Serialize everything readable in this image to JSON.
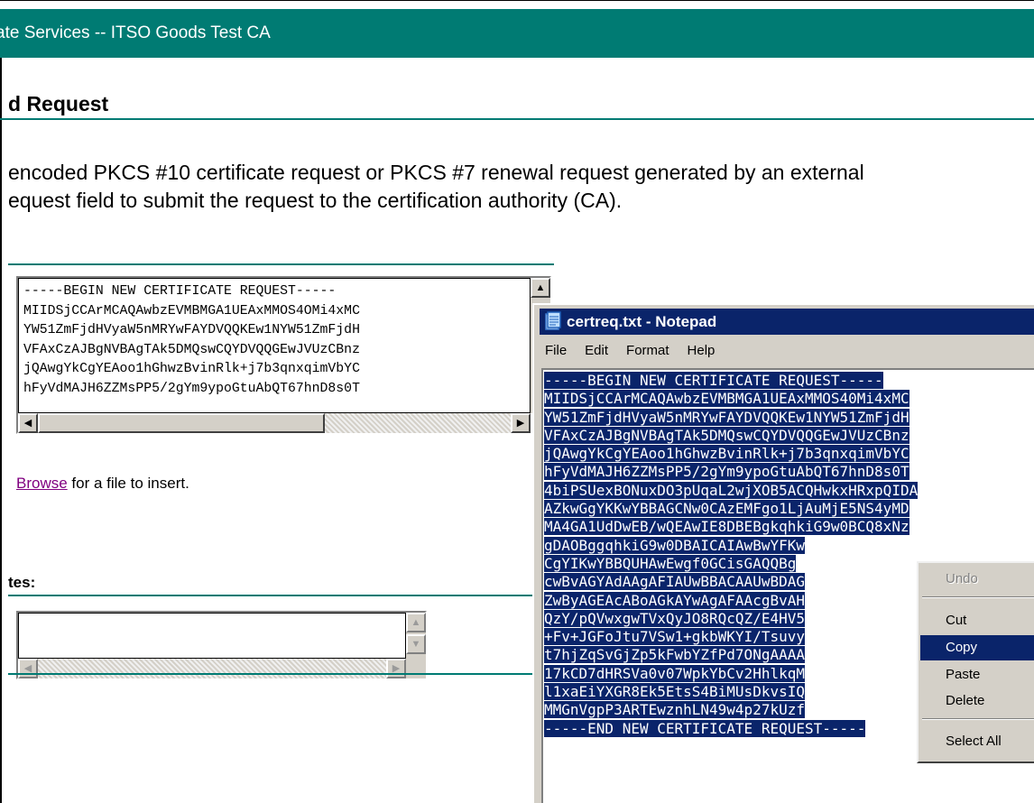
{
  "banner": {
    "title": "ate Services  --  ITSO Goods Test CA"
  },
  "page": {
    "heading": "d Request",
    "description_line1": " encoded PKCS #10 certificate request or PKCS #7 renewal request generated by an external",
    "description_line2": "equest field to submit the request to the certification authority (CA).",
    "browse_link": "Browse",
    "browse_suffix": " for a file to insert.",
    "attributes_label": "tes:"
  },
  "request_box": {
    "lines": [
      "-----BEGIN NEW CERTIFICATE REQUEST-----",
      "MIIDSjCCArMCAQAwbzEVMBMGA1UEAxMMOS4OMi4xMC",
      "YW51ZmFjdHVyaW5nMRYwFAYDVQQKEw1NYW51ZmFjdH",
      "VFAxCzAJBgNVBAgTAk5DMQswCQYDVQQGEwJVUzCBnz",
      "jQAwgYkCgYEAoo1hGhwzBvinRlk+j7b3qnxqimVbYC",
      "hFyVdMAJH6ZZMsPP5/2gYm9ypoGtuAbQT67hnD8s0T"
    ]
  },
  "notepad": {
    "title": "certreq.txt - Notepad",
    "menu": [
      "File",
      "Edit",
      "Format",
      "Help"
    ],
    "lines": [
      "-----BEGIN NEW CERTIFICATE REQUEST-----",
      "MIIDSjCCArMCAQAwbzEVMBMGA1UEAxMMOS40Mi4xMC",
      "YW51ZmFjdHVyaW5nMRYwFAYDVQQKEw1NYW51ZmFjdH",
      "VFAxCzAJBgNVBAgTAk5DMQswCQYDVQQGEwJVUzCBnz",
      "jQAwgYkCgYEAoo1hGhwzBvinRlk+j7b3qnxqimVbYC",
      "hFyVdMAJH6ZZMsPP5/2gYm9ypoGtuAbQT67hnD8s0T",
      "4biPSUexBONuxDO3pUqaL2wjXOB5ACQHwkxHRxpQIDA",
      "AZkwGgYKKwYBBAGCNw0CAzEMFgo1LjAuMjE5NS4yMD",
      "MA4GA1UdDwEB/wQEAwIE8DBEBgkqhkiG9w0BCQ8xNz",
      "gDAOBggqhkiG9w0DBAICAIAwBwYFKw",
      "CgYIKwYBBQUHAwEwgf0GCisGAQQBg",
      "cwBvAGYAdAAgAFIAUwBBACAAUwBDAG",
      "ZwByAGEAcABoAGkAYwAgAFAAcgBvAH",
      "QzY/pQVwxgwTVxQyJO8RQcQZ/E4HV5",
      "+Fv+JGFoJtu7VSw1+gkbWKYI/Tsuvy",
      "t7hjZqSvGjZp5kFwbYZfPd7ONgAAAA",
      "17kCD7dHRSVa0v07WpkYbCv2HhlkqM",
      "l1xaEiYXGR8Ek5EtsS4BiMUsDkvsIQ",
      "MMGnVgpP3ARTEwznhLN49w4p27kUzf",
      "-----END NEW CERTIFICATE REQUEST-----"
    ]
  },
  "context_menu": {
    "undo": "Undo",
    "cut": "Cut",
    "copy": "Copy",
    "paste": "Paste",
    "delete": "Delete",
    "select_all": "Select All"
  },
  "colors": {
    "banner": "#007b73",
    "selection": "#0a246a",
    "link_visited": "#800080"
  }
}
